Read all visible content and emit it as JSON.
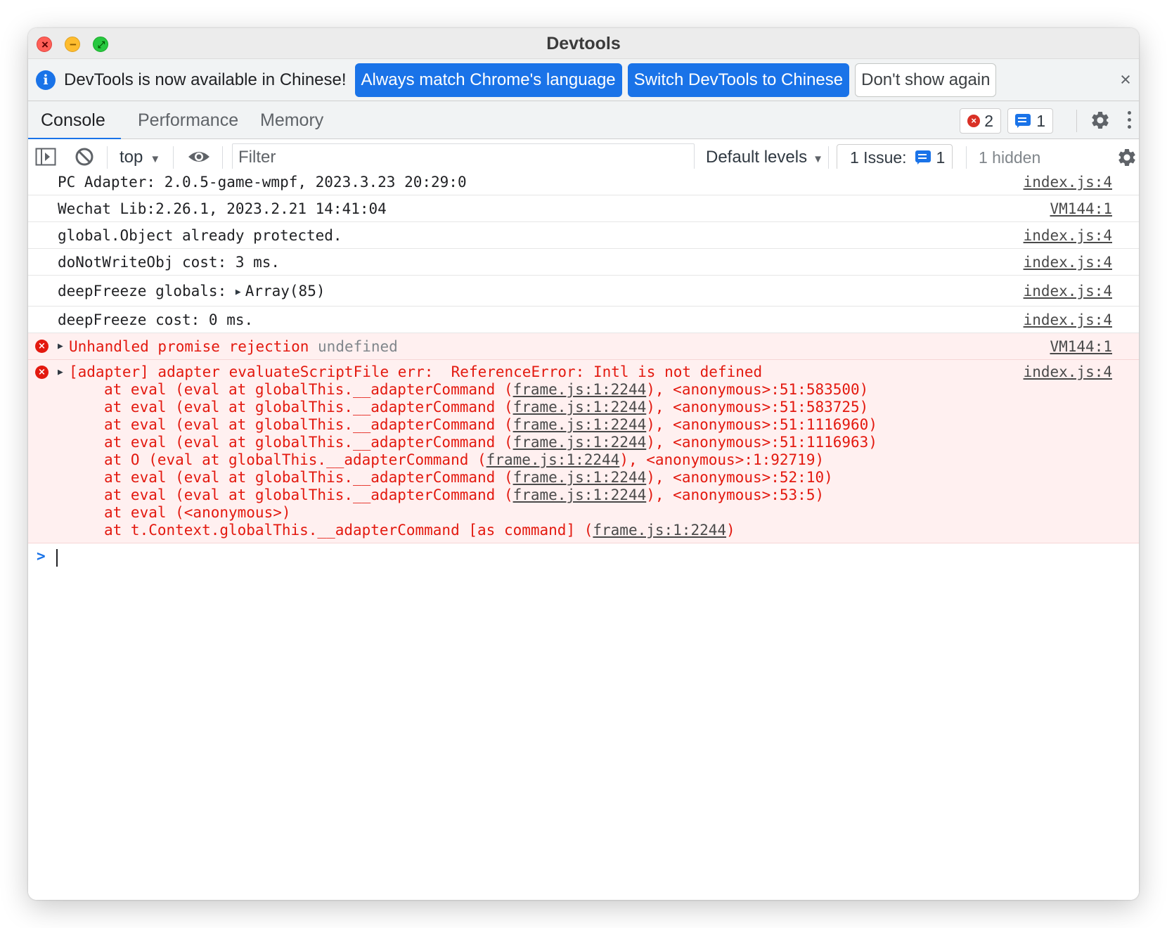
{
  "window": {
    "title": "Devtools",
    "controls": {
      "close": "×",
      "minimize": "−",
      "maximize": "⤢"
    }
  },
  "infobar": {
    "message": "DevTools is now available in Chinese!",
    "buttons": {
      "match_language": "Always match Chrome's language",
      "switch_chinese": "Switch DevTools to Chinese",
      "dont_show": "Don't show again"
    },
    "close": "×",
    "info_icon": "i"
  },
  "tabs": [
    {
      "label": "Console",
      "active": true
    },
    {
      "label": "Performance",
      "active": false
    },
    {
      "label": "Memory",
      "active": false
    }
  ],
  "counters": {
    "errors": "2",
    "issues": "1",
    "error_icon_glyph": "×"
  },
  "toolbar": {
    "context": "top",
    "filter_placeholder": "Filter",
    "levels": "Default levels",
    "issues_label": "1 Issue:",
    "issues_count": "1",
    "hidden": "1 hidden",
    "dropdown_arrow": "▼"
  },
  "messages": [
    {
      "text": "PC Adapter: 2.0.5-game-wmpf, 2023.3.23 20:29:0",
      "source": "index.js:4"
    },
    {
      "text": "Wechat Lib:2.26.1, 2023.2.21 14:41:04",
      "source": "VM144:1"
    },
    {
      "text": "global.Object already protected.",
      "source": "index.js:4"
    },
    {
      "text": "doNotWriteObj cost: 3 ms.",
      "source": "index.js:4"
    },
    {
      "text": "deepFreeze globals: ",
      "expand": "Array(85)",
      "source": "index.js:4"
    },
    {
      "text": "deepFreeze cost: 0 ms.",
      "source": "index.js:4"
    }
  ],
  "errors": {
    "rejection": {
      "text": "Unhandled promise rejection",
      "detail": "undefined",
      "source": "VM144:1"
    },
    "adapter": {
      "text": "[adapter] adapter evaluateScriptFile err:  ReferenceError: Intl is not defined",
      "source": "index.js:4",
      "stack": [
        {
          "pre": "at eval (eval at globalThis.__adapterCommand (",
          "link": "frame.js:1:2244",
          "post": "), <anonymous>:51:583500)"
        },
        {
          "pre": "at eval (eval at globalThis.__adapterCommand (",
          "link": "frame.js:1:2244",
          "post": "), <anonymous>:51:583725)"
        },
        {
          "pre": "at eval (eval at globalThis.__adapterCommand (",
          "link": "frame.js:1:2244",
          "post": "), <anonymous>:51:1116960)"
        },
        {
          "pre": "at eval (eval at globalThis.__adapterCommand (",
          "link": "frame.js:1:2244",
          "post": "), <anonymous>:51:1116963)"
        },
        {
          "pre": "at O (eval at globalThis.__adapterCommand (",
          "link": "frame.js:1:2244",
          "post": "), <anonymous>:1:92719)"
        },
        {
          "pre": "at eval (eval at globalThis.__adapterCommand (",
          "link": "frame.js:1:2244",
          "post": "), <anonymous>:52:10)"
        },
        {
          "pre": "at eval (eval at globalThis.__adapterCommand (",
          "link": "frame.js:1:2244",
          "post": "), <anonymous>:53:5)"
        },
        {
          "pre": "at eval (<anonymous>)",
          "link": "",
          "post": ""
        },
        {
          "pre": "at t.Context.globalThis.__adapterCommand [as command] (",
          "link": "frame.js:1:2244",
          "post": ")"
        }
      ]
    }
  },
  "prompt": {
    "chevron": ">"
  },
  "colors": {
    "accent": "#1a73e8",
    "error": "#e3190f",
    "error_bg": "#fff0f0"
  }
}
